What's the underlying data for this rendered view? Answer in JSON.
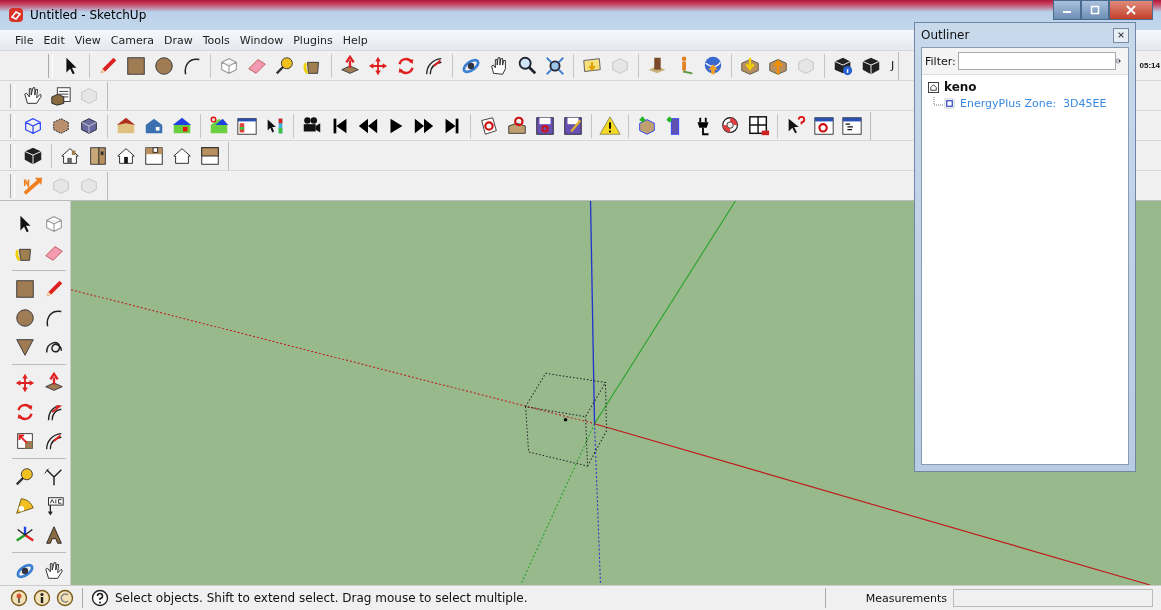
{
  "window": {
    "title": "Untitled - SketchUp"
  },
  "menu": [
    "File",
    "Edit",
    "View",
    "Camera",
    "Draw",
    "Tools",
    "Window",
    "Plugins",
    "Help"
  ],
  "toolbar_texts": [
    "J",
    "05:14"
  ],
  "outliner": {
    "title": "Outliner",
    "filter_label": "Filter:",
    "tree": [
      {
        "label": "keno",
        "children": [
          {
            "label": "EnergyPlus Zone:  3D45EE"
          }
        ]
      }
    ]
  },
  "status_bar": {
    "message": "Select objects. Shift to extend select. Drag mouse to select multiple.",
    "measurements_label": "Measurements"
  }
}
